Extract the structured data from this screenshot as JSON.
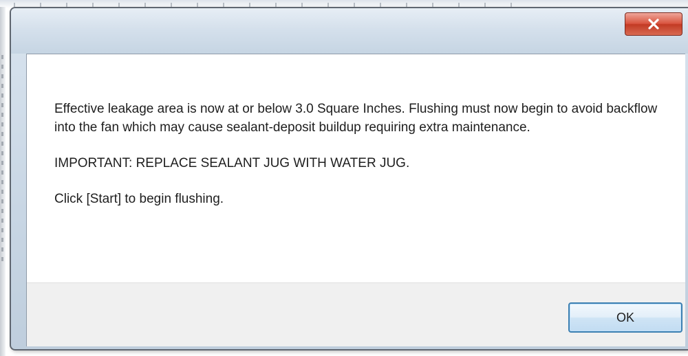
{
  "dialog": {
    "close_icon": "close-x-icon",
    "message": {
      "paragraph_1": "Effective leakage area is now at or below 3.0 Square Inches. Flushing must now begin to avoid backflow into the fan which may cause sealant-deposit buildup requiring extra maintenance.",
      "paragraph_2": "IMPORTANT: REPLACE SEALANT JUG WITH WATER JUG.",
      "paragraph_3": "Click [Start] to begin flushing."
    },
    "ok_label": "OK"
  },
  "colors": {
    "close_button": "#c9432c",
    "ok_border": "#3c7fb1",
    "footer_bg": "#f0f0f0"
  }
}
